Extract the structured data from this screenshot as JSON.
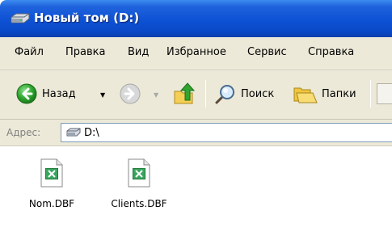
{
  "window": {
    "title": "Новый том (D:)",
    "title_icon": "drive-icon"
  },
  "menu": {
    "items": [
      "Файл",
      "Правка",
      "Вид",
      "Избранное",
      "Сервис",
      "Справка"
    ]
  },
  "toolbar": {
    "back_label": "Назад",
    "search_label": "Поиск",
    "folders_label": "Папки"
  },
  "address": {
    "label": "Адрес:",
    "value": "D:\\"
  },
  "files": [
    {
      "name": "Nom.DBF",
      "icon": "excel-file-icon"
    },
    {
      "name": "Clients.DBF",
      "icon": "excel-file-icon"
    }
  ],
  "colors": {
    "titlebar": "#0d51d5",
    "chrome": "#ece9d8",
    "back_green": "#2fa52f",
    "excel_green": "#1e7a3c"
  }
}
